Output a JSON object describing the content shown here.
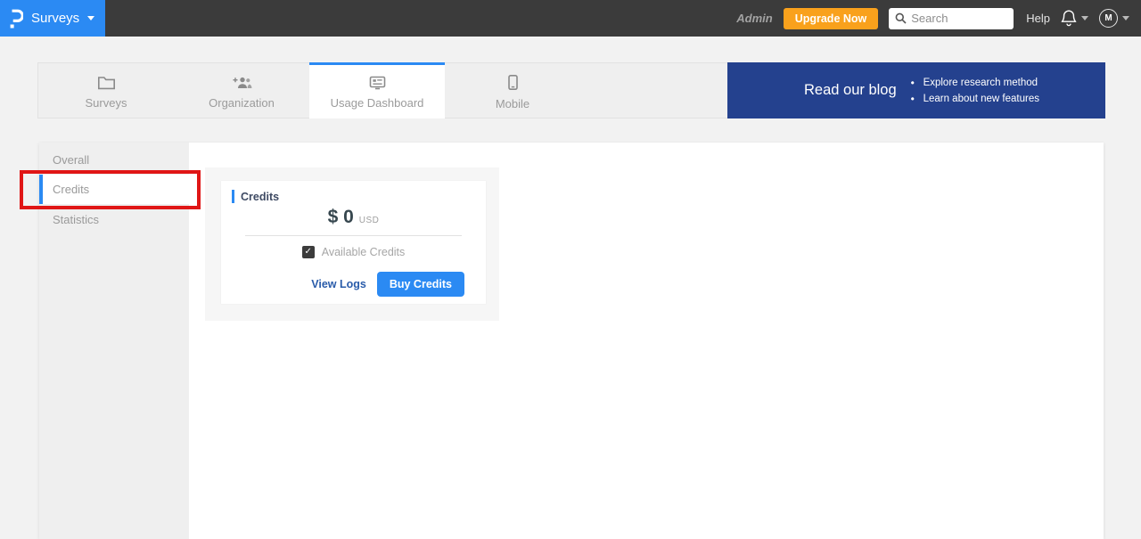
{
  "topbar": {
    "product": "Surveys",
    "admin_label": "Admin",
    "upgrade_label": "Upgrade Now",
    "search_placeholder": "Search",
    "help_label": "Help",
    "avatar_initial": "M"
  },
  "tabs": {
    "items": [
      {
        "label": "Surveys",
        "icon": "folder-icon",
        "active": false
      },
      {
        "label": "Organization",
        "icon": "people-add-icon",
        "active": false
      },
      {
        "label": "Usage Dashboard",
        "icon": "dashboard-icon",
        "active": true
      },
      {
        "label": "Mobile",
        "icon": "mobile-icon",
        "active": false
      }
    ],
    "blog": {
      "title": "Read our blog",
      "bullets": [
        "Explore research method",
        "Learn about new features"
      ]
    }
  },
  "sidebar": {
    "items": [
      {
        "label": "Overall",
        "active": false
      },
      {
        "label": "Credits",
        "active": true,
        "annotated": true
      },
      {
        "label": "Statistics",
        "active": false
      }
    ]
  },
  "credits_card": {
    "title": "Credits",
    "amount": "$ 0",
    "currency": "USD",
    "available_label": "Available Credits",
    "check_glyph": "✓",
    "view_logs_label": "View Logs",
    "buy_credits_label": "Buy Credits"
  },
  "icons": {
    "logo": "prolific-p-icon",
    "search": "magnifier-icon",
    "notifications": "bell-icon",
    "tab_surveys": "folder-icon",
    "tab_organization": "people-add-icon",
    "tab_usage": "dashboard-icon",
    "tab_mobile": "mobile-icon"
  },
  "colors": {
    "accent_blue": "#2b8af3",
    "navy_banner": "#24418e",
    "upgrade_orange": "#f9a11c",
    "annotation_red": "#e01616",
    "topbar_dark": "#3b3b3b"
  }
}
